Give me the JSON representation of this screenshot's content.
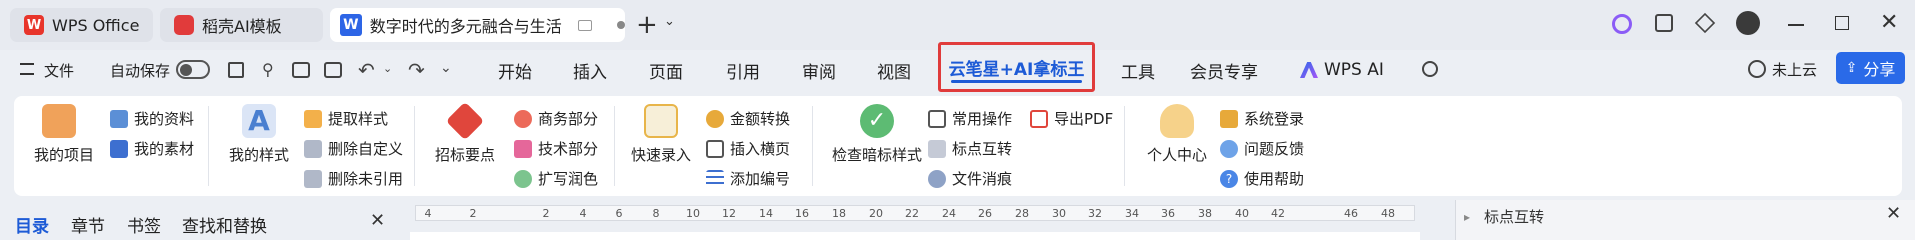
{
  "tabs": [
    {
      "label": "WPS Office"
    },
    {
      "label": "稻壳AI模板"
    },
    {
      "label": "数字时代的多元融合与生活"
    }
  ],
  "menu": {
    "file": "文件",
    "autosave": "自动保存",
    "items": [
      "开始",
      "插入",
      "页面",
      "引用",
      "审阅",
      "视图"
    ],
    "active": "云笔星+AI拿标王",
    "items_after": [
      "工具",
      "会员专享"
    ],
    "wps_ai": "WPS AI",
    "cloud": "未上云",
    "share": "分享"
  },
  "ribbon": {
    "my_project": "我的项目",
    "my_data": "我的资料",
    "my_material": "我的素材",
    "my_style": "我的样式",
    "extract_style": "提取样式",
    "delete_custom": "删除自定义",
    "delete_unused": "删除未引用",
    "bid_points": "招标要点",
    "business_part": "商务部分",
    "tech_part": "技术部分",
    "expand_polish": "扩写润色",
    "quick_input": "快速录入",
    "amount_convert": "金额转换",
    "insert_banner": "插入横页",
    "add_number": "添加编号",
    "check_mark": "检查暗标样式",
    "common_ops": "常用操作",
    "punct_convert": "标点互转",
    "file_clear": "文件消痕",
    "export_pdf": "导出PDF",
    "personal_center": "个人中心",
    "system_login": "系统登录",
    "feedback": "问题反馈",
    "help": "使用帮助"
  },
  "nav": {
    "tabs": [
      "目录",
      "章节",
      "书签",
      "查找和替换"
    ]
  },
  "ruler": {
    "ticks": [
      "4",
      "2",
      "2",
      "4",
      "6",
      "8",
      "10",
      "12",
      "14",
      "16",
      "18",
      "20",
      "22",
      "24",
      "26",
      "28",
      "30",
      "32",
      "34",
      "36",
      "38",
      "40",
      "42",
      "46",
      "48"
    ]
  },
  "right_pane": {
    "title": "标点互转"
  },
  "colors": {
    "accent": "#2a6ae8",
    "active_outline": "#e03b3b",
    "active_text": "#1d5bd6"
  }
}
